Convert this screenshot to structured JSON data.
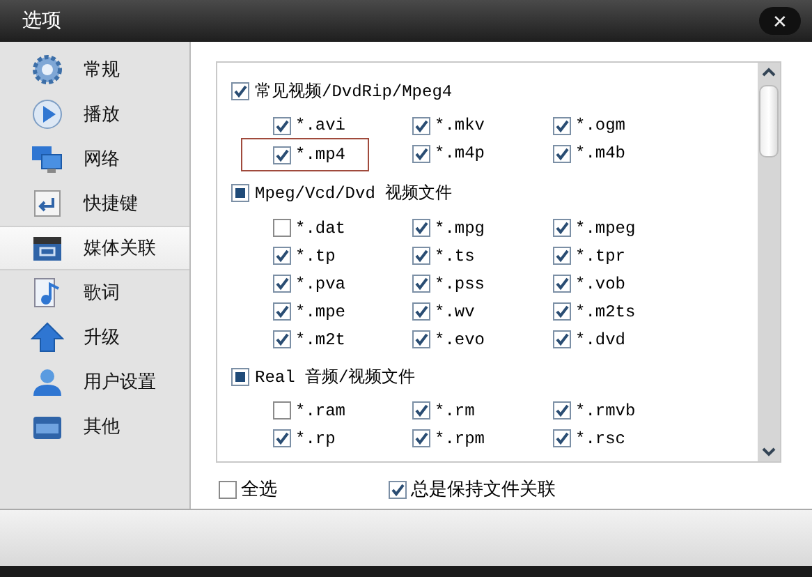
{
  "window": {
    "title": "选项",
    "close": "✕"
  },
  "sidebar": {
    "items": [
      {
        "label": "常规",
        "selected": false
      },
      {
        "label": "播放",
        "selected": false
      },
      {
        "label": "网络",
        "selected": false
      },
      {
        "label": "快捷键",
        "selected": false
      },
      {
        "label": "媒体关联",
        "selected": true
      },
      {
        "label": "歌词",
        "selected": false
      },
      {
        "label": "升级",
        "selected": false
      },
      {
        "label": "用户设置",
        "selected": false
      },
      {
        "label": "其他",
        "selected": false
      }
    ]
  },
  "groups": [
    {
      "label": "常见视频/DvdRip/Mpeg4",
      "checked": true,
      "mixed": false,
      "items": [
        {
          "label": "*.avi",
          "checked": true,
          "highlighted": false
        },
        {
          "label": "*.mkv",
          "checked": true,
          "highlighted": false
        },
        {
          "label": "*.ogm",
          "checked": true,
          "highlighted": false
        },
        {
          "label": "*.mp4",
          "checked": true,
          "highlighted": true
        },
        {
          "label": "*.m4p",
          "checked": true,
          "highlighted": false
        },
        {
          "label": "*.m4b",
          "checked": true,
          "highlighted": false
        }
      ]
    },
    {
      "label": "Mpeg/Vcd/Dvd 视频文件",
      "checked": false,
      "mixed": true,
      "items": [
        {
          "label": "*.dat",
          "checked": false,
          "highlighted": false
        },
        {
          "label": "*.mpg",
          "checked": true,
          "highlighted": false
        },
        {
          "label": "*.mpeg",
          "checked": true,
          "highlighted": false
        },
        {
          "label": "*.tp",
          "checked": true,
          "highlighted": false
        },
        {
          "label": "*.ts",
          "checked": true,
          "highlighted": false
        },
        {
          "label": "*.tpr",
          "checked": true,
          "highlighted": false
        },
        {
          "label": "*.pva",
          "checked": true,
          "highlighted": false
        },
        {
          "label": "*.pss",
          "checked": true,
          "highlighted": false
        },
        {
          "label": "*.vob",
          "checked": true,
          "highlighted": false
        },
        {
          "label": "*.mpe",
          "checked": true,
          "highlighted": false
        },
        {
          "label": "*.wv",
          "checked": true,
          "highlighted": false
        },
        {
          "label": "*.m2ts",
          "checked": true,
          "highlighted": false
        },
        {
          "label": "*.m2t",
          "checked": true,
          "highlighted": false
        },
        {
          "label": "*.evo",
          "checked": true,
          "highlighted": false
        },
        {
          "label": "*.dvd",
          "checked": true,
          "highlighted": false
        }
      ]
    },
    {
      "label": "Real 音频/视频文件",
      "checked": false,
      "mixed": true,
      "items": [
        {
          "label": "*.ram",
          "checked": false,
          "highlighted": false
        },
        {
          "label": "*.rm",
          "checked": true,
          "highlighted": false
        },
        {
          "label": "*.rmvb",
          "checked": true,
          "highlighted": false
        },
        {
          "label": "*.rp",
          "checked": true,
          "highlighted": false
        },
        {
          "label": "*.rpm",
          "checked": true,
          "highlighted": false
        },
        {
          "label": "*.rsc",
          "checked": true,
          "highlighted": false
        }
      ]
    }
  ],
  "options": [
    {
      "label": "全选",
      "checked": false
    },
    {
      "label": "总是保持文件关联",
      "checked": true
    }
  ]
}
